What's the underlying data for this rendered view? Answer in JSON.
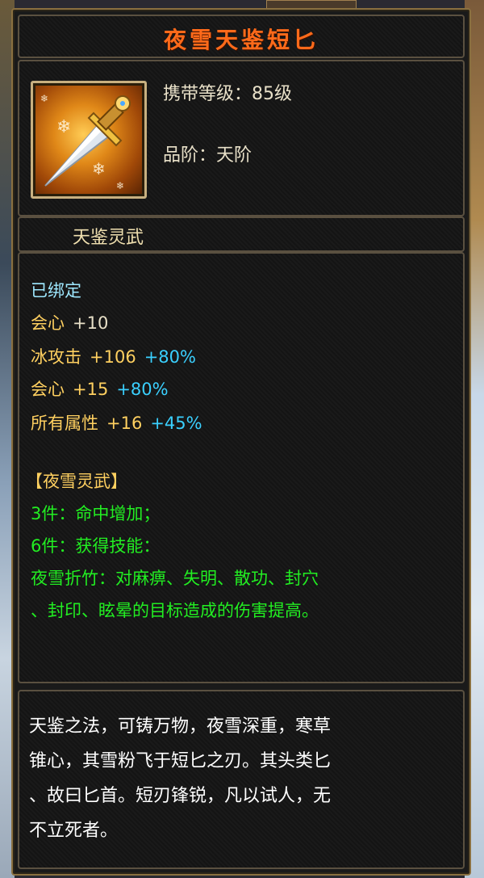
{
  "item": {
    "name": "夜雪天鉴短匕",
    "level_line": "携带等级：85级",
    "rank_line": "品阶：天阶",
    "series": "天鉴灵武",
    "icon": "dagger-icon"
  },
  "stats": {
    "bound": "已绑定",
    "crit1_label": "会心",
    "crit1_value": "+10",
    "ice_label": "冰攻击",
    "ice_value": "+106",
    "ice_bonus": "+80%",
    "crit2_label": "会心",
    "crit2_value": "+15",
    "crit2_bonus": "+80%",
    "all_label": "所有属性",
    "all_value": "+16",
    "all_bonus": "+45%"
  },
  "set": {
    "name": "【夜雪灵武】",
    "bonus3": "3件：命中增加；",
    "bonus6": "6件：获得技能：",
    "skill_line1": "夜雪折竹：对麻痹、失明、散功、封穴",
    "skill_line2": "、封印、眩晕的目标造成的伤害提高。"
  },
  "description": {
    "line1": "天鉴之法，可铸万物，夜雪深重，寒草",
    "line2": "锥心，其雪粉飞于短匕之刃。其头类匕",
    "line3": "、故曰匕首。短刃锋锐，凡以试人，无",
    "line4": "不立死者。"
  },
  "colors": {
    "title": "#ff6a1a",
    "bound": "#9ee8ff",
    "gold_stat": "#ffd060",
    "percent": "#3ad0ff",
    "set_green": "#22ee22",
    "border": "#8a7040"
  }
}
